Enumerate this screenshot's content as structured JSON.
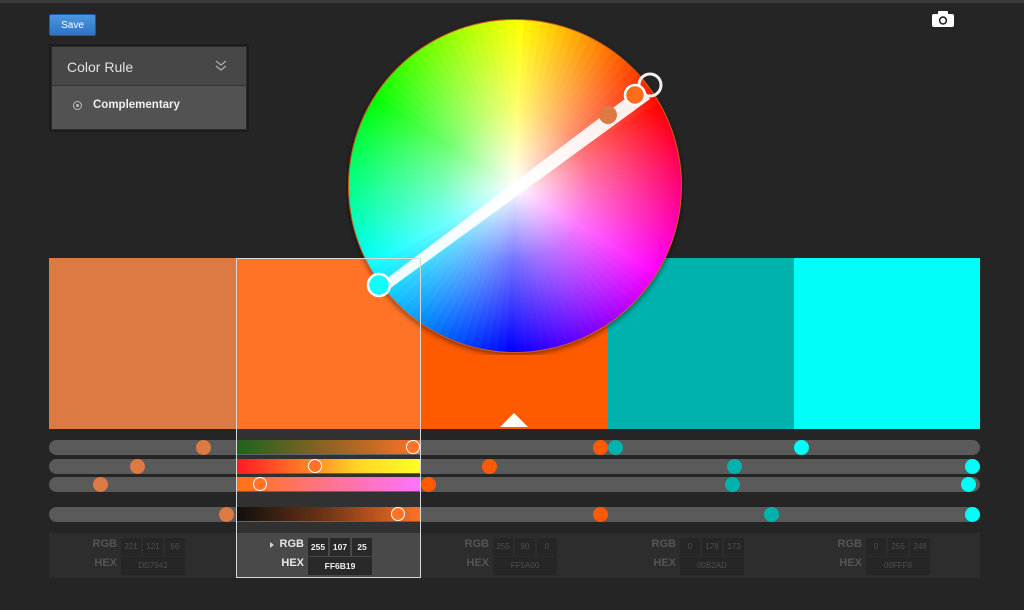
{
  "toolbar": {
    "save_label": "Save",
    "camera_icon": "camera-icon"
  },
  "color_rule": {
    "title": "Color Rule",
    "chevron_icon": "double-chevron-down-icon",
    "selected": "Complementary"
  },
  "swatches": [
    {
      "name": "swatch-1",
      "hex": "#DD7942"
    },
    {
      "name": "swatch-2",
      "hex": "#FF6B19"
    },
    {
      "name": "swatch-3",
      "hex": "#FF5A00"
    },
    {
      "name": "swatch-4",
      "hex": "#00B2AD"
    },
    {
      "name": "swatch-5",
      "hex": "#00FFF8"
    }
  ],
  "selected_swatch": 2,
  "values": {
    "rgb_label": "RGB",
    "hex_label": "HEX",
    "swatch_1": {
      "r": "221",
      "g": "121",
      "b": "66",
      "hex": "DD7942"
    },
    "swatch_2": {
      "r": "255",
      "g": "107",
      "b": "25",
      "hex": "FF6B19"
    },
    "swatch_3": {
      "r": "255",
      "g": "90",
      "b": "0",
      "hex": "FF5A00"
    },
    "swatch_4": {
      "r": "0",
      "g": "178",
      "b": "173",
      "hex": "00B2AD"
    },
    "swatch_5": {
      "r": "0",
      "g": "255",
      "b": "248",
      "hex": "00FFF8"
    }
  },
  "colors": {
    "background": "#252525",
    "accent_blue": "#3a86d4",
    "track": "#5a5a5a"
  }
}
